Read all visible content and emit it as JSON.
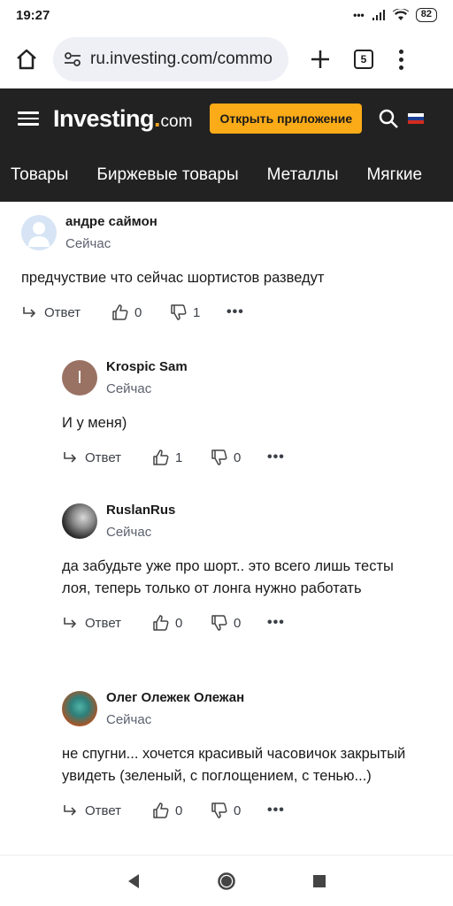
{
  "status_bar": {
    "time": "19:27",
    "signal_text": "•••",
    "battery": "82"
  },
  "browser": {
    "url": "ru.investing.com/commo",
    "tab_count": "5"
  },
  "site": {
    "logo_main": "Investing",
    "logo_dot": ".",
    "logo_com": "com",
    "open_app_label": "Открыть приложение",
    "accent_color": "#fbab18",
    "header_bg": "#222222"
  },
  "categories": [
    "Товары",
    "Биржевые товары",
    "Металлы",
    "Мягкие"
  ],
  "comments": [
    {
      "author": "андре саймон",
      "time": "Сейчас",
      "text": "предчуствие что сейчас шортистов разведут",
      "reply_label": "Ответ",
      "likes": "0",
      "dislikes": "1",
      "avatar": "default-user-icon"
    },
    {
      "author": "Krospic Sam",
      "time": "Сейчас",
      "text": "И у меня)",
      "reply_label": "Ответ",
      "likes": "1",
      "dislikes": "0",
      "avatar_letter": "I"
    },
    {
      "author": "RuslanRus",
      "time": "Сейчас",
      "text": "да забудьте уже про шорт.. это всего лишь тесты лоя, теперь только от лонга нужно работать",
      "reply_label": "Ответ",
      "likes": "0",
      "dislikes": "0",
      "avatar": "photo-avatar"
    },
    {
      "author": "Олег Олежек Олежан",
      "time": "Сейчас",
      "text": "не спугни... хочется красивый часовичок закрытый увидеть (зеленый, с поглощением, с тенью...)",
      "reply_label": "Ответ",
      "likes": "0",
      "dislikes": "0",
      "avatar": "photo-avatar"
    }
  ]
}
